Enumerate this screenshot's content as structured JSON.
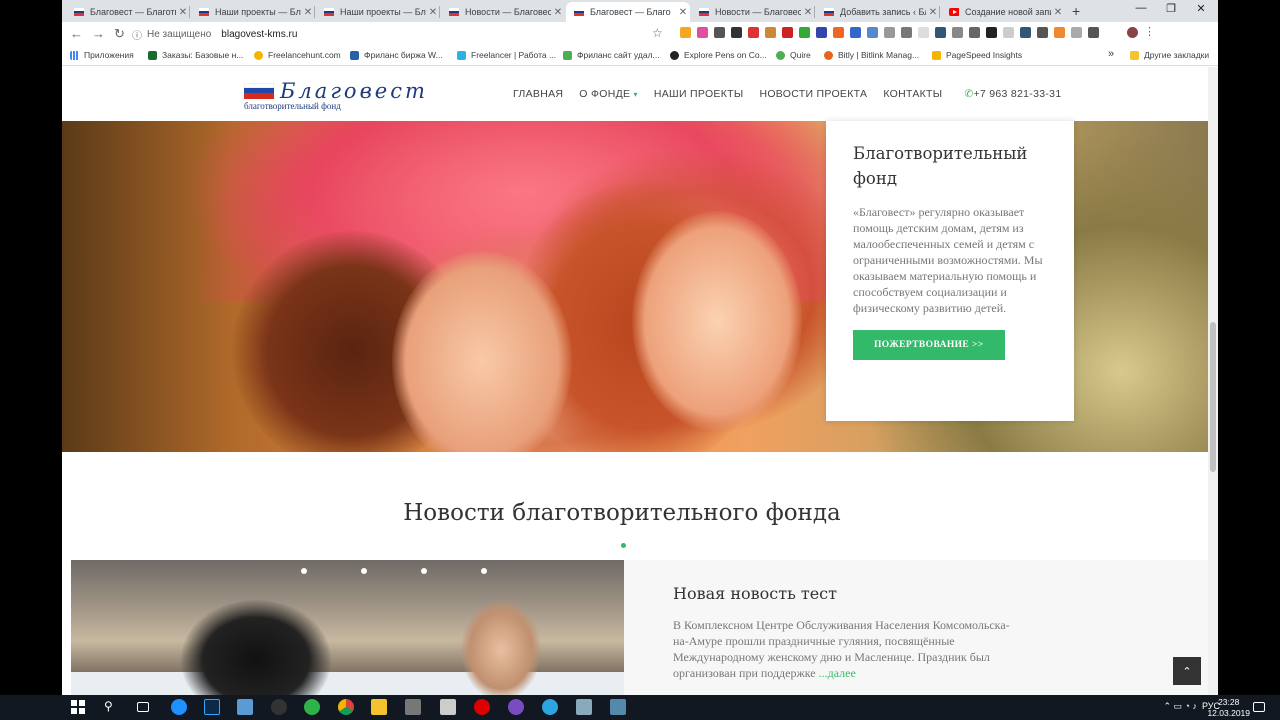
{
  "browser": {
    "tabs": [
      {
        "title": "Благовест — Благотв",
        "active": false
      },
      {
        "title": "Наши проекты — Бл",
        "active": false
      },
      {
        "title": "Наши проекты — Бл",
        "active": false
      },
      {
        "title": "Новости — Благовес",
        "active": false
      },
      {
        "title": "Благовест — Благо",
        "active": true
      },
      {
        "title": "Новости — Благовес",
        "active": false
      },
      {
        "title": "Добавить запись ‹ Бл",
        "active": false
      },
      {
        "title": "Создание новой запи",
        "active": false
      }
    ],
    "new_tab": "+",
    "security": "Не защищено",
    "url": "blagovest-kms.ru"
  },
  "bookmarks": {
    "items": [
      "Приложения",
      "Заказы: Базовые н...",
      "Freelancehunt.com",
      "Фриланс биржа W...",
      "Freelancer | Работа ...",
      "Фриланс сайт удал...",
      "Explore Pens on Co...",
      "Quire",
      "Bitly | Bitlink Manag...",
      "PageSpeed Insights"
    ],
    "more": "»",
    "other": "Другие закладки"
  },
  "site": {
    "logo_name": "Благовест",
    "logo_tagline": "благотворительный фонд",
    "nav": [
      "ГЛАВНАЯ",
      "О ФОНДЕ",
      "НАШИ ПРОЕКТЫ",
      "НОВОСТИ ПРОЕКТА",
      "КОНТАКТЫ"
    ],
    "phone": "+7 963 821-33-31"
  },
  "hero_card": {
    "title": "Благотворительный фонд",
    "text": "«Благовест» регулярно оказывает помощь детским домам, детям из малообеспеченных семей и детям с ограниченными возможностями. Мы оказываем материальную помощь и способствуем социализации и физическому развитию детей.",
    "button": "ПОЖЕРТВОВАНИЕ >>"
  },
  "news": {
    "heading": "Новости благотворительного фонда",
    "item": {
      "title": "Новая новость тест",
      "text": "В Комплексном Центре Обслуживания  Населения Комсомольска-на-Амуре прошли праздничные гуляния, посвящённые Международному женскому дню и Масленице.  Праздник  был организован при поддержке ",
      "more": "...далее"
    }
  },
  "taskbar": {
    "lang": "РУС",
    "time": "23:28",
    "date": "12.03.2019"
  },
  "colors": {
    "accent": "#33b96a",
    "logo": "#1e3a7b"
  }
}
